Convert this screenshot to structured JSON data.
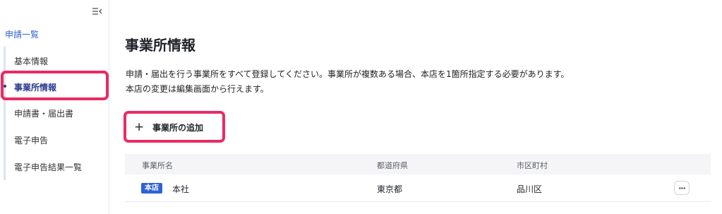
{
  "sidebar": {
    "title": "申請一覧",
    "items": [
      {
        "label": "基本情報"
      },
      {
        "label": "事業所情報"
      },
      {
        "label": "申請書・届出書"
      },
      {
        "label": "電子申告"
      },
      {
        "label": "電子申告結果一覧"
      }
    ]
  },
  "main": {
    "title": "事業所情報",
    "description": [
      "申請・届出を行う事業所をすべて登録してください。事業所が複数ある場合、本店を1箇所指定する必要があります。",
      "本店の変更は編集画面から行えます。"
    ],
    "add_button": {
      "icon": "+",
      "label": "事業所の追加"
    },
    "table": {
      "columns": [
        "事業所名",
        "都道府県",
        "市区町村"
      ],
      "rows": [
        {
          "badge": "本店",
          "name": "本社",
          "prefecture": "東京都",
          "city": "品川区",
          "menu": "···"
        }
      ]
    }
  },
  "colors": {
    "accent": "#2f62d6",
    "highlight": "#ea2b63",
    "active_nav": "#2a3a8c"
  }
}
